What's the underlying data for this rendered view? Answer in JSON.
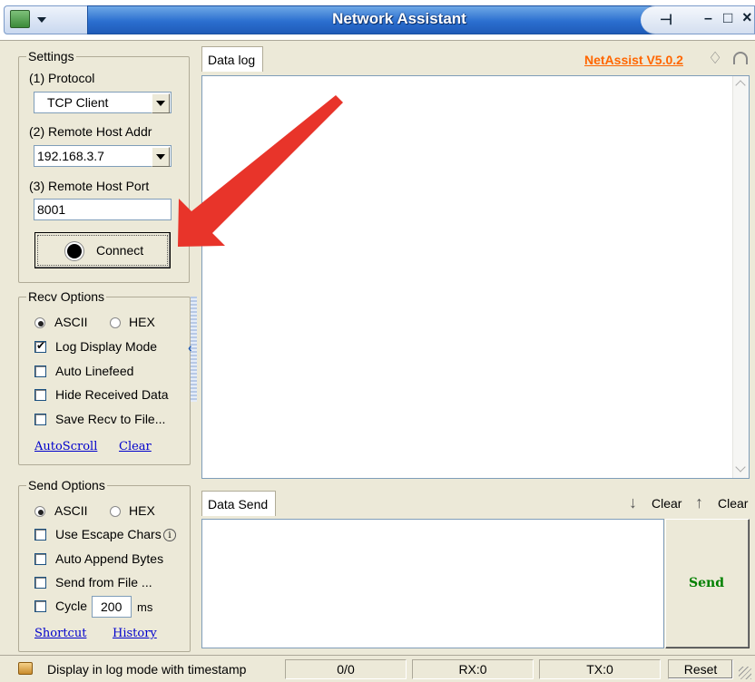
{
  "window": {
    "title": "Network Assistant",
    "pin_glyph": "⊣",
    "minimize_glyph": "–",
    "maximize_glyph": "□",
    "close_glyph": "×"
  },
  "brand": {
    "label": "NetAssist V5.0.2"
  },
  "settings": {
    "legend": "Settings",
    "protocol_label": "(1) Protocol",
    "protocol_value": "TCP Client",
    "host_label": "(2) Remote Host Addr",
    "host_value": "192.168.3.7",
    "port_label": "(3) Remote Host Port",
    "port_value": "8001",
    "connect_label": "Connect"
  },
  "recv": {
    "legend": "Recv Options",
    "ascii": "ASCII",
    "hex": "HEX",
    "format_selected": "ASCII",
    "options": [
      {
        "label": "Log Display Mode",
        "checked": true
      },
      {
        "label": "Auto Linefeed",
        "checked": false
      },
      {
        "label": "Hide Received Data",
        "checked": false
      },
      {
        "label": "Save Recv to File...",
        "checked": false
      }
    ],
    "autoscroll": "AutoScroll",
    "clear": "Clear"
  },
  "send": {
    "legend": "Send Options",
    "ascii": "ASCII",
    "hex": "HEX",
    "format_selected": "ASCII",
    "escape": "Use Escape Chars",
    "append": "Auto Append Bytes",
    "from_file": "Send from File ...",
    "cycle": "Cycle",
    "cycle_value": "200",
    "cycle_unit": "ms",
    "shortcut": "Shortcut",
    "history": "History"
  },
  "datalog": {
    "tab": "Data log"
  },
  "datasend": {
    "tab": "Data Send",
    "clear1": "Clear",
    "clear2": "Clear",
    "send_button": "Send"
  },
  "status": {
    "message": "Display in log mode with timestamp",
    "counter": "0/0",
    "rx": "RX:0",
    "tx": "TX:0",
    "reset": "Reset"
  },
  "colors": {
    "accent": "#2b6fd0",
    "brand": "#ff6600",
    "send_text": "#008000",
    "arrow": "#e8342a"
  }
}
